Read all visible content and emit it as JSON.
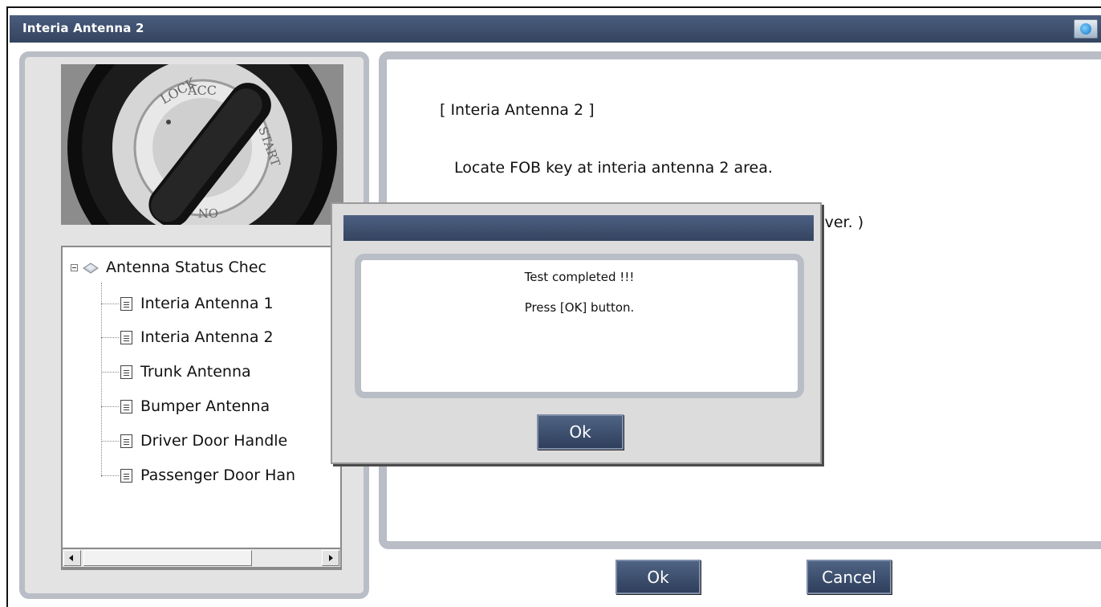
{
  "window": {
    "title": "Interia Antenna 2",
    "system_icon": "app-globe-icon"
  },
  "tree": {
    "root_label": "Antenna Status Chec",
    "root_icon": "antenna-icon",
    "items": [
      {
        "label": "Interia Antenna 1"
      },
      {
        "label": "Interia Antenna 2"
      },
      {
        "label": "Trunk Antenna"
      },
      {
        "label": "Bumper Antenna"
      },
      {
        "label": "Driver Door Handle"
      },
      {
        "label": "Passenger Door Han"
      }
    ]
  },
  "photo": {
    "ring_texts": [
      "LOCK",
      "ACC",
      "START",
      "ON"
    ]
  },
  "main": {
    "heading": "[ Interia Antenna 2 ]",
    "instruction": "Locate FOB key at interia antenna 2 area.",
    "partial_text": "over. )"
  },
  "dialog": {
    "title": "",
    "line1": "Test completed !!!",
    "line2": "Press [OK] button.",
    "ok_label": "Ok"
  },
  "footer": {
    "ok_label": "Ok",
    "cancel_label": "Cancel"
  },
  "colors": {
    "titlebar": "#34445f",
    "button": "#3b4c6b",
    "panel_border": "#b9bdc6"
  }
}
